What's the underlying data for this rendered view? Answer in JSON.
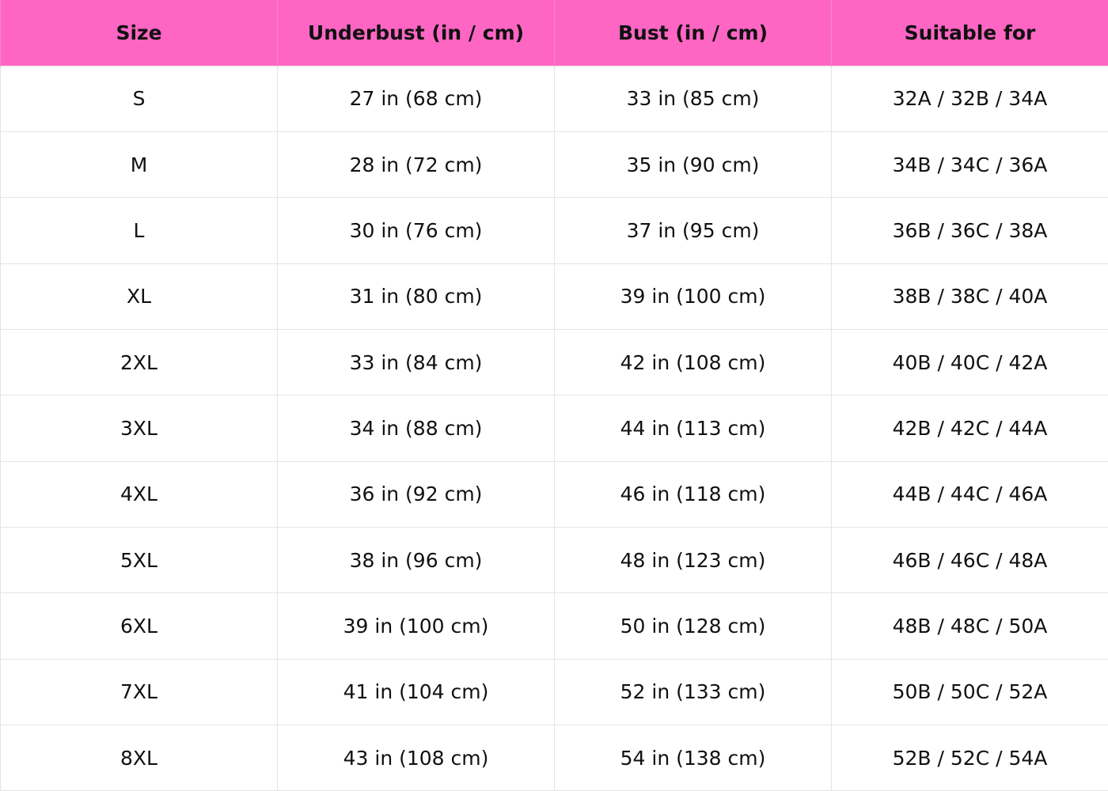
{
  "colors": {
    "header_background": "#ff66c4",
    "grid_line": "#e4e4e4",
    "text": "#111111"
  },
  "table": {
    "headers": [
      "Size",
      "Underbust (in / cm)",
      "Bust (in / cm)",
      "Suitable for"
    ],
    "rows": [
      [
        "S",
        "27 in (68 cm)",
        "33 in (85 cm)",
        "32A / 32B / 34A"
      ],
      [
        "M",
        "28 in (72 cm)",
        "35 in (90 cm)",
        "34B / 34C / 36A"
      ],
      [
        "L",
        "30 in (76 cm)",
        "37 in (95 cm)",
        "36B / 36C / 38A"
      ],
      [
        "XL",
        "31 in (80 cm)",
        "39 in (100 cm)",
        "38B / 38C / 40A"
      ],
      [
        "2XL",
        "33 in (84 cm)",
        "42 in (108 cm)",
        "40B / 40C / 42A"
      ],
      [
        "3XL",
        "34 in (88 cm)",
        "44 in (113 cm)",
        "42B / 42C / 44A"
      ],
      [
        "4XL",
        "36 in (92 cm)",
        "46 in (118 cm)",
        "44B / 44C / 46A"
      ],
      [
        "5XL",
        "38 in (96 cm)",
        "48 in (123 cm)",
        "46B / 46C / 48A"
      ],
      [
        "6XL",
        "39 in (100 cm)",
        "50 in (128 cm)",
        "48B / 48C / 50A"
      ],
      [
        "7XL",
        "41 in (104 cm)",
        "52 in (133 cm)",
        "50B / 50C / 52A"
      ],
      [
        "8XL",
        "43 in (108 cm)",
        "54 in (138 cm)",
        "52B / 52C / 54A"
      ]
    ]
  }
}
